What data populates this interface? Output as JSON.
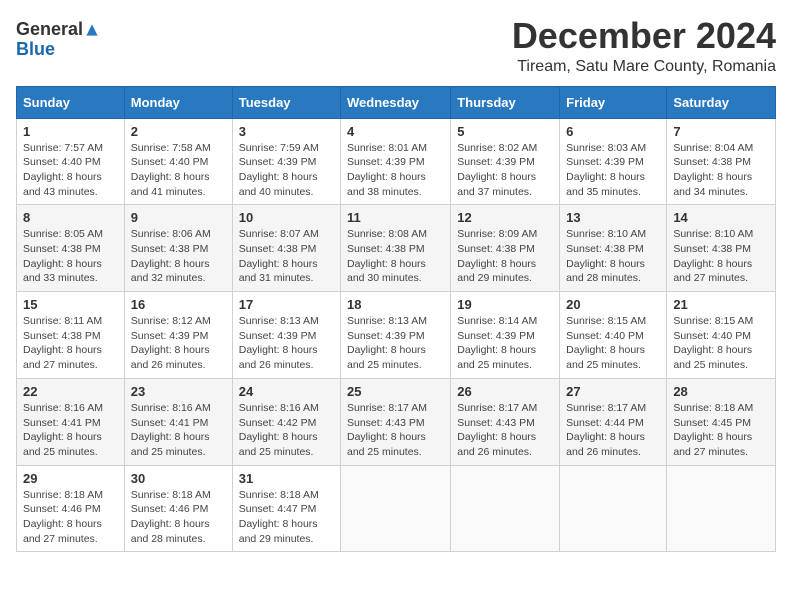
{
  "logo": {
    "general": "General",
    "blue": "Blue"
  },
  "title": "December 2024",
  "subtitle": "Tiream, Satu Mare County, Romania",
  "header": {
    "days": [
      "Sunday",
      "Monday",
      "Tuesday",
      "Wednesday",
      "Thursday",
      "Friday",
      "Saturday"
    ]
  },
  "weeks": [
    [
      {
        "day": "1",
        "sunrise": "Sunrise: 7:57 AM",
        "sunset": "Sunset: 4:40 PM",
        "daylight": "Daylight: 8 hours and 43 minutes."
      },
      {
        "day": "2",
        "sunrise": "Sunrise: 7:58 AM",
        "sunset": "Sunset: 4:40 PM",
        "daylight": "Daylight: 8 hours and 41 minutes."
      },
      {
        "day": "3",
        "sunrise": "Sunrise: 7:59 AM",
        "sunset": "Sunset: 4:39 PM",
        "daylight": "Daylight: 8 hours and 40 minutes."
      },
      {
        "day": "4",
        "sunrise": "Sunrise: 8:01 AM",
        "sunset": "Sunset: 4:39 PM",
        "daylight": "Daylight: 8 hours and 38 minutes."
      },
      {
        "day": "5",
        "sunrise": "Sunrise: 8:02 AM",
        "sunset": "Sunset: 4:39 PM",
        "daylight": "Daylight: 8 hours and 37 minutes."
      },
      {
        "day": "6",
        "sunrise": "Sunrise: 8:03 AM",
        "sunset": "Sunset: 4:39 PM",
        "daylight": "Daylight: 8 hours and 35 minutes."
      },
      {
        "day": "7",
        "sunrise": "Sunrise: 8:04 AM",
        "sunset": "Sunset: 4:38 PM",
        "daylight": "Daylight: 8 hours and 34 minutes."
      }
    ],
    [
      {
        "day": "8",
        "sunrise": "Sunrise: 8:05 AM",
        "sunset": "Sunset: 4:38 PM",
        "daylight": "Daylight: 8 hours and 33 minutes."
      },
      {
        "day": "9",
        "sunrise": "Sunrise: 8:06 AM",
        "sunset": "Sunset: 4:38 PM",
        "daylight": "Daylight: 8 hours and 32 minutes."
      },
      {
        "day": "10",
        "sunrise": "Sunrise: 8:07 AM",
        "sunset": "Sunset: 4:38 PM",
        "daylight": "Daylight: 8 hours and 31 minutes."
      },
      {
        "day": "11",
        "sunrise": "Sunrise: 8:08 AM",
        "sunset": "Sunset: 4:38 PM",
        "daylight": "Daylight: 8 hours and 30 minutes."
      },
      {
        "day": "12",
        "sunrise": "Sunrise: 8:09 AM",
        "sunset": "Sunset: 4:38 PM",
        "daylight": "Daylight: 8 hours and 29 minutes."
      },
      {
        "day": "13",
        "sunrise": "Sunrise: 8:10 AM",
        "sunset": "Sunset: 4:38 PM",
        "daylight": "Daylight: 8 hours and 28 minutes."
      },
      {
        "day": "14",
        "sunrise": "Sunrise: 8:10 AM",
        "sunset": "Sunset: 4:38 PM",
        "daylight": "Daylight: 8 hours and 27 minutes."
      }
    ],
    [
      {
        "day": "15",
        "sunrise": "Sunrise: 8:11 AM",
        "sunset": "Sunset: 4:38 PM",
        "daylight": "Daylight: 8 hours and 27 minutes."
      },
      {
        "day": "16",
        "sunrise": "Sunrise: 8:12 AM",
        "sunset": "Sunset: 4:39 PM",
        "daylight": "Daylight: 8 hours and 26 minutes."
      },
      {
        "day": "17",
        "sunrise": "Sunrise: 8:13 AM",
        "sunset": "Sunset: 4:39 PM",
        "daylight": "Daylight: 8 hours and 26 minutes."
      },
      {
        "day": "18",
        "sunrise": "Sunrise: 8:13 AM",
        "sunset": "Sunset: 4:39 PM",
        "daylight": "Daylight: 8 hours and 25 minutes."
      },
      {
        "day": "19",
        "sunrise": "Sunrise: 8:14 AM",
        "sunset": "Sunset: 4:39 PM",
        "daylight": "Daylight: 8 hours and 25 minutes."
      },
      {
        "day": "20",
        "sunrise": "Sunrise: 8:15 AM",
        "sunset": "Sunset: 4:40 PM",
        "daylight": "Daylight: 8 hours and 25 minutes."
      },
      {
        "day": "21",
        "sunrise": "Sunrise: 8:15 AM",
        "sunset": "Sunset: 4:40 PM",
        "daylight": "Daylight: 8 hours and 25 minutes."
      }
    ],
    [
      {
        "day": "22",
        "sunrise": "Sunrise: 8:16 AM",
        "sunset": "Sunset: 4:41 PM",
        "daylight": "Daylight: 8 hours and 25 minutes."
      },
      {
        "day": "23",
        "sunrise": "Sunrise: 8:16 AM",
        "sunset": "Sunset: 4:41 PM",
        "daylight": "Daylight: 8 hours and 25 minutes."
      },
      {
        "day": "24",
        "sunrise": "Sunrise: 8:16 AM",
        "sunset": "Sunset: 4:42 PM",
        "daylight": "Daylight: 8 hours and 25 minutes."
      },
      {
        "day": "25",
        "sunrise": "Sunrise: 8:17 AM",
        "sunset": "Sunset: 4:43 PM",
        "daylight": "Daylight: 8 hours and 25 minutes."
      },
      {
        "day": "26",
        "sunrise": "Sunrise: 8:17 AM",
        "sunset": "Sunset: 4:43 PM",
        "daylight": "Daylight: 8 hours and 26 minutes."
      },
      {
        "day": "27",
        "sunrise": "Sunrise: 8:17 AM",
        "sunset": "Sunset: 4:44 PM",
        "daylight": "Daylight: 8 hours and 26 minutes."
      },
      {
        "day": "28",
        "sunrise": "Sunrise: 8:18 AM",
        "sunset": "Sunset: 4:45 PM",
        "daylight": "Daylight: 8 hours and 27 minutes."
      }
    ],
    [
      {
        "day": "29",
        "sunrise": "Sunrise: 8:18 AM",
        "sunset": "Sunset: 4:46 PM",
        "daylight": "Daylight: 8 hours and 27 minutes."
      },
      {
        "day": "30",
        "sunrise": "Sunrise: 8:18 AM",
        "sunset": "Sunset: 4:46 PM",
        "daylight": "Daylight: 8 hours and 28 minutes."
      },
      {
        "day": "31",
        "sunrise": "Sunrise: 8:18 AM",
        "sunset": "Sunset: 4:47 PM",
        "daylight": "Daylight: 8 hours and 29 minutes."
      },
      null,
      null,
      null,
      null
    ]
  ]
}
